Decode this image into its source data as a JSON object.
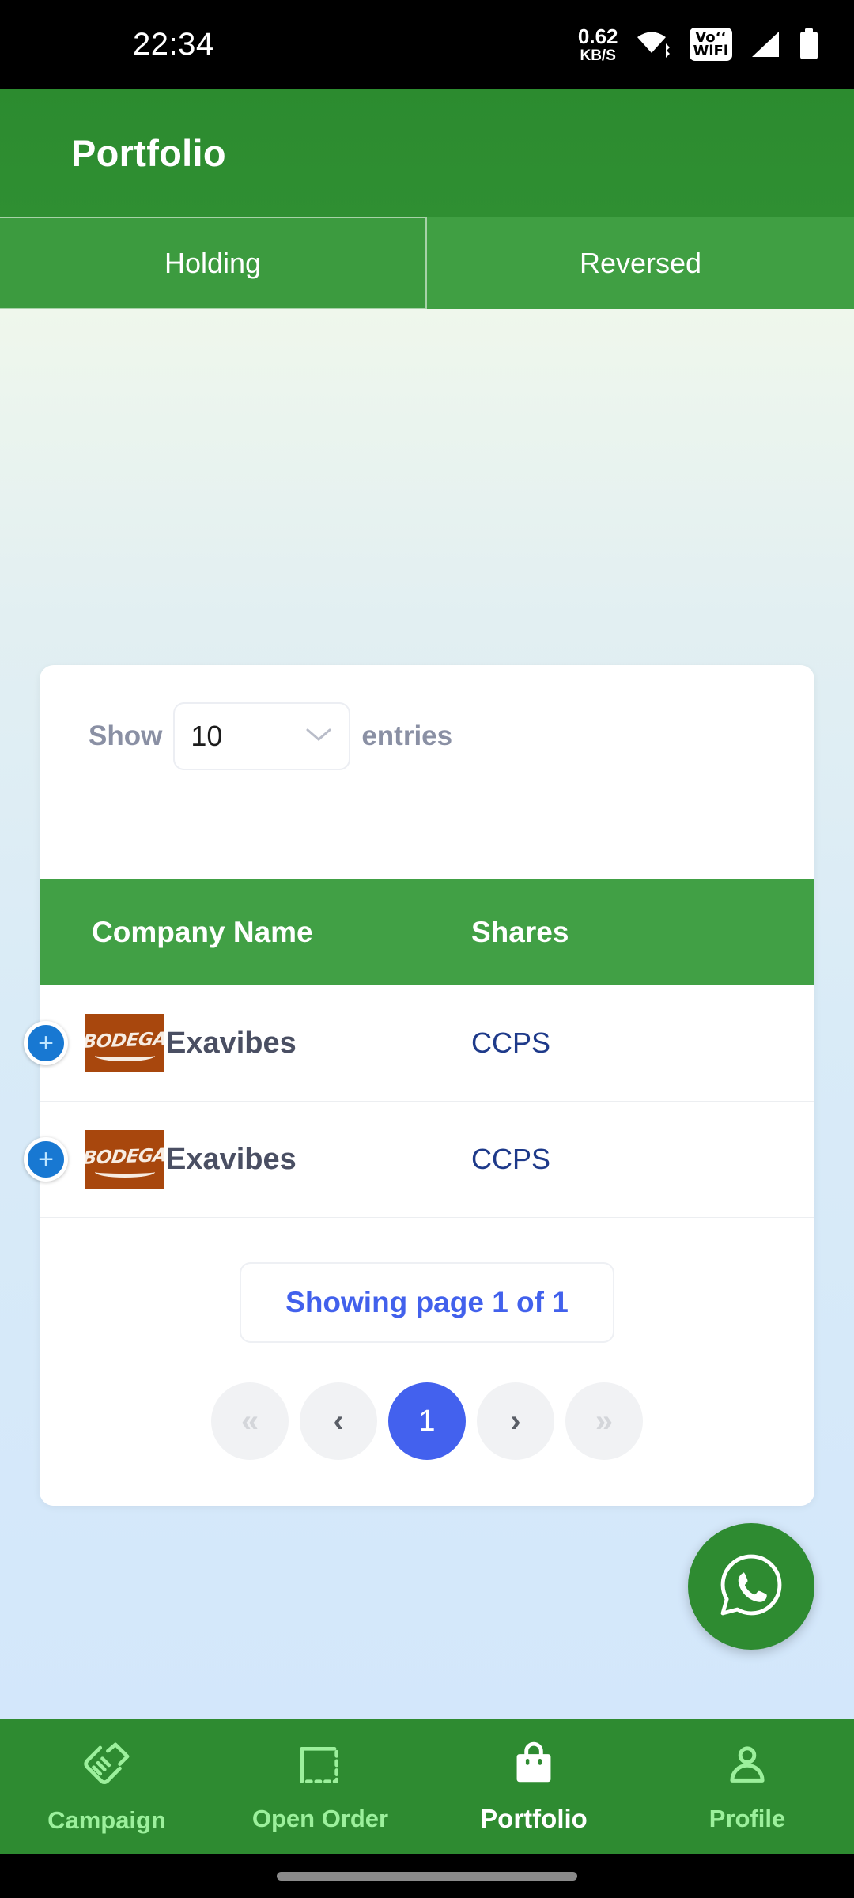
{
  "status_bar": {
    "time": "22:34",
    "net_speed_value": "0.62",
    "net_speed_unit": "KB/S",
    "vowifi_line1": "Vo‘‘",
    "vowifi_line2": "WiFi",
    "icons": [
      "wifi-icon",
      "vowifi-icon",
      "cellular-signal-icon",
      "battery-icon"
    ]
  },
  "app_bar": {
    "title": "Portfolio"
  },
  "tabs": [
    {
      "label": "Holding",
      "active": true
    },
    {
      "label": "Reversed",
      "active": false
    }
  ],
  "entries_control": {
    "prefix_label": "Show",
    "selected_value": "10",
    "suffix_label": "entries",
    "chevron_icon": "chevron-down-icon"
  },
  "table": {
    "columns": [
      "Company Name",
      "Shares"
    ],
    "rows": [
      {
        "expand_icon": "plus-icon",
        "logo_text": "BODEGA",
        "company": "Exavibes",
        "shares": "CCPS"
      },
      {
        "expand_icon": "plus-icon",
        "logo_text": "BODEGA",
        "company": "Exavibes",
        "shares": "CCPS"
      }
    ]
  },
  "pagination": {
    "showing_text": "Showing page 1 of 1",
    "first_label": "«",
    "prev_label": "‹",
    "current_page": "1",
    "next_label": "›",
    "last_label": "»"
  },
  "fab": {
    "icon": "whatsapp-icon"
  },
  "bottom_nav": [
    {
      "label": "Campaign",
      "icon": "handshake-icon",
      "active": false
    },
    {
      "label": "Open Order",
      "icon": "dashed-box-icon",
      "active": false
    },
    {
      "label": "Portfolio",
      "icon": "shopping-bag-icon",
      "active": true
    },
    {
      "label": "Profile",
      "icon": "person-icon",
      "active": false
    }
  ],
  "colors": {
    "app_bar_green": "#2c8b2f",
    "tab_green": "#3c9b3f",
    "table_header_green": "#41a045",
    "nav_green": "#2e8b31",
    "nav_inactive_text": "#9cf09c",
    "accent_blue": "#4361ee",
    "link_blue": "#4261ec",
    "plus_blue": "#1878d2",
    "shares_blue": "#1e3a8a",
    "logo_orange": "#a8470d",
    "muted_label": "#8a90a4"
  }
}
